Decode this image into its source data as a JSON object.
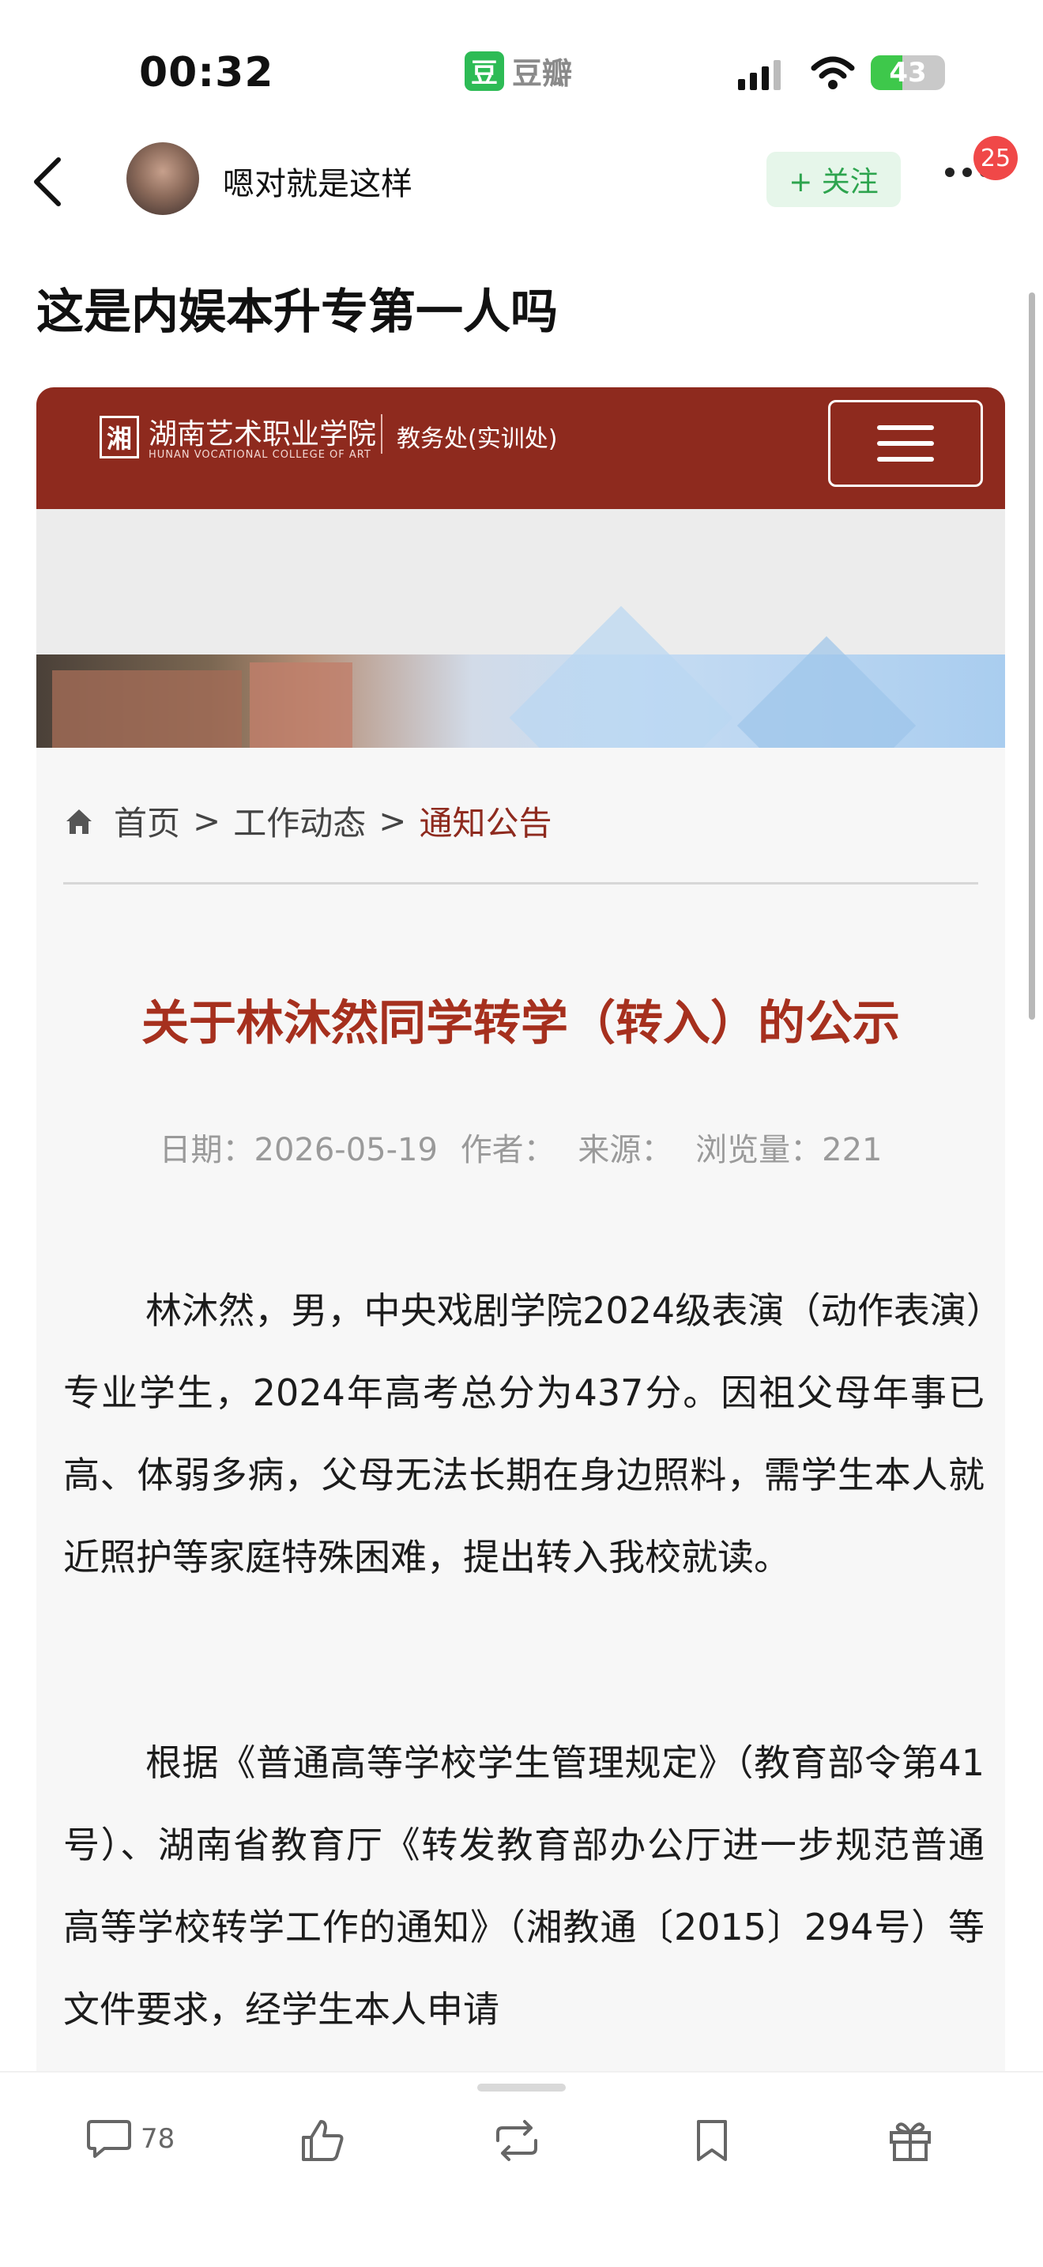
{
  "status_bar": {
    "time": "00:32",
    "app_logo": "豆",
    "app_name": "豆瓣",
    "battery": "43",
    "battery_level": 0.43
  },
  "nav": {
    "username": "嗯对就是这样",
    "follow_label": "+ 关注",
    "notification_count": "25"
  },
  "post": {
    "title": "这是内娱本升专第一人吗"
  },
  "screenshot": {
    "college_name": "湖南艺术职业学院",
    "college_name_en": "HUNAN VOCATIONAL COLLEGE OF ART",
    "department": "教务处(实训处)",
    "breadcrumb": [
      "首页",
      "工作动态",
      "通知公告"
    ],
    "article_title": "关于林沐然同学转学（转入）的公示",
    "meta": {
      "date": "日期：2026-05-19",
      "author": "作者：",
      "source": "来源：",
      "views": "浏览量：221"
    },
    "paragraphs": [
      "林沐然，男，中央戏剧学院2024级表演（动作表演）专业学生，2024年高考总分为437分。因祖父母年事已高、体弱多病，父母无法长期在身边照料，需学生本人就近照护等家庭特殊困难，提出转入我校就读。",
      "根据《普通高等学校学生管理规定》（教育部令第41号）、湖南省教育厅《转发教育部办公厅进一步规范普通高等学校转学工作的通知》（湘教通〔2015〕294号）等文件要求，经学生本人申请"
    ]
  },
  "toolbar": {
    "comment_count": "78"
  },
  "colors": {
    "header_red": "#8e2a1e",
    "title_red": "#a6301e",
    "douban_green": "#2dbb55",
    "follow_green": "#2da44e",
    "badge_red": "#f04848"
  },
  "icons": [
    "back-icon",
    "wifi-icon",
    "signal-icon",
    "battery-icon",
    "more-icon",
    "home-icon",
    "comment-icon",
    "like-icon",
    "repost-icon",
    "collect-icon",
    "gift-icon"
  ]
}
